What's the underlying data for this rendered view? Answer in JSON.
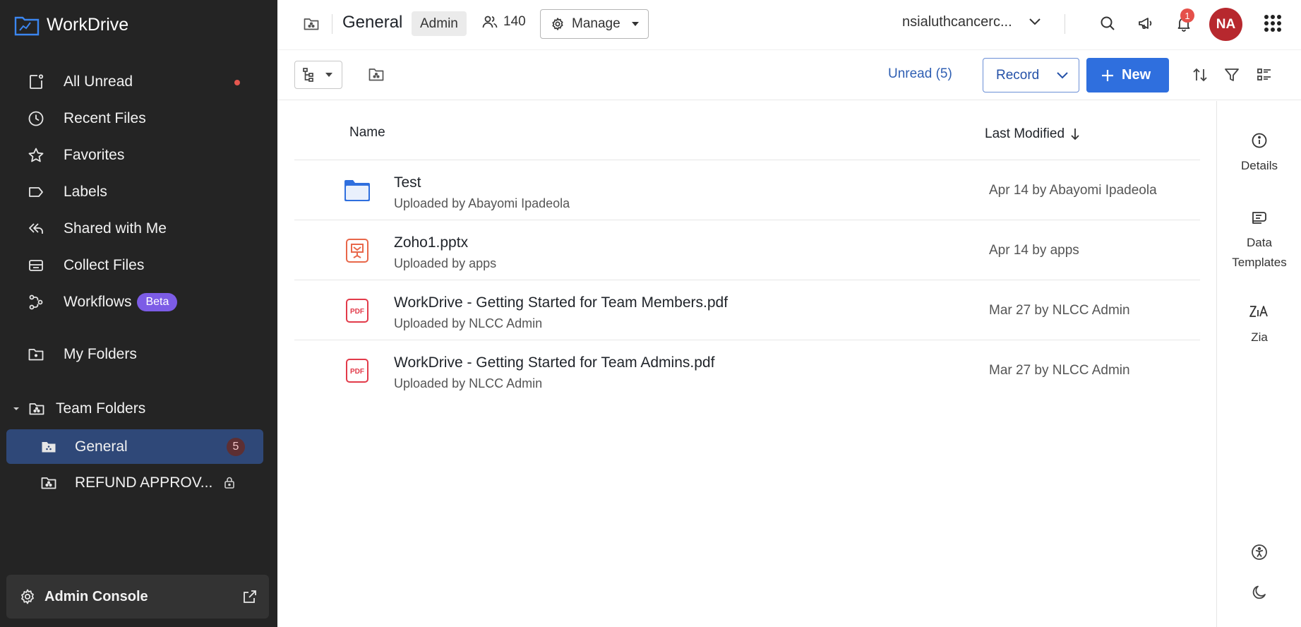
{
  "brand": {
    "name": "WorkDrive"
  },
  "sidebar": {
    "items": [
      {
        "label": "All Unread",
        "icon": "all-unread-icon"
      },
      {
        "label": "Recent Files",
        "icon": "clock-icon"
      },
      {
        "label": "Favorites",
        "icon": "star-icon"
      },
      {
        "label": "Labels",
        "icon": "label-icon"
      },
      {
        "label": "Shared with Me",
        "icon": "share-icon"
      },
      {
        "label": "Collect Files",
        "icon": "inbox-icon"
      },
      {
        "label": "Workflows",
        "icon": "workflow-icon",
        "badge": "Beta"
      }
    ],
    "my_folders": "My Folders",
    "team_folders": "Team Folders",
    "team_items": [
      {
        "label": "General",
        "count": "5"
      },
      {
        "label": "REFUND APPROV..."
      }
    ],
    "admin_console": "Admin Console"
  },
  "topbar": {
    "title": "General",
    "role": "Admin",
    "members": "140",
    "manage": "Manage",
    "org": "nsialuthcancerc...",
    "notifications": "1",
    "avatar": "NA"
  },
  "toolbar": {
    "unread": "Unread (5)",
    "record": "Record",
    "new": "New"
  },
  "table": {
    "columns": {
      "name": "Name",
      "modified": "Last Modified"
    },
    "rows": [
      {
        "name": "Test",
        "sub": "Uploaded by Abayomi Ipadeola",
        "modified": "Apr 14 by Abayomi Ipadeola",
        "type": "folder"
      },
      {
        "name": "Zoho1.pptx",
        "sub": "Uploaded by apps",
        "modified": "Apr 14 by apps",
        "type": "pptx"
      },
      {
        "name": "WorkDrive - Getting Started for Team Members.pdf",
        "sub": "Uploaded by NLCC Admin",
        "modified": "Mar 27 by NLCC Admin",
        "type": "pdf",
        "icon_text": "PDF"
      },
      {
        "name": "WorkDrive - Getting Started for Team Admins.pdf",
        "sub": "Uploaded by NLCC Admin",
        "modified": "Mar 27 by NLCC Admin",
        "type": "pdf",
        "icon_text": "PDF"
      }
    ]
  },
  "rpanel": {
    "details": "Details",
    "templates_line1": "Data",
    "templates_line2": "Templates",
    "zia": "Zia"
  },
  "colors": {
    "sidebar_bg": "#242424",
    "active_item": "#2f4878",
    "accent": "#2f6fde",
    "beta": "#7c5ce6",
    "avatar": "#b7282e"
  }
}
